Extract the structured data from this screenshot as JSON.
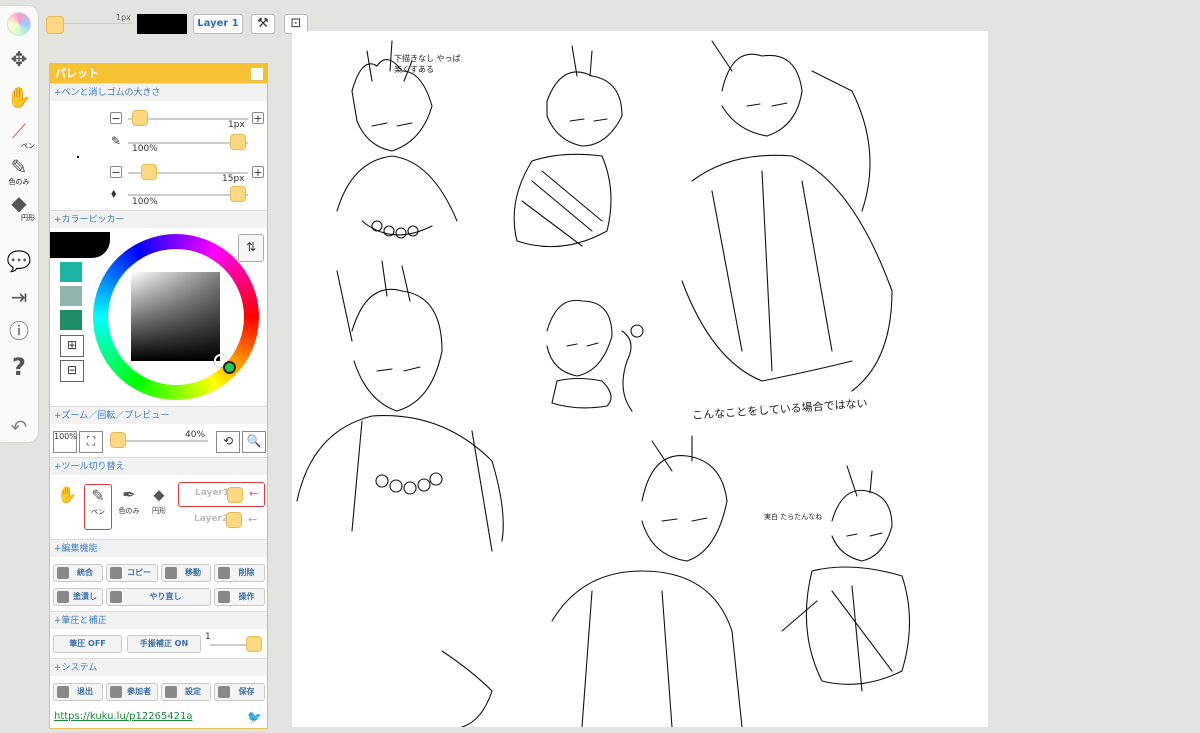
{
  "topbar": {
    "pen_size": "1px",
    "layer_label": "Layer 1",
    "current_color": "#000000"
  },
  "toolstrip": {
    "pen_label": "ペン",
    "eyedropper_label": "色のみ",
    "shape_label": "円形"
  },
  "palette": {
    "title": "パレット",
    "sections": {
      "brush_size": "+ペンと消しゴムの大きさ",
      "color_picker": "+カラーピッカー",
      "zoom": "+ズーム／回転／プレビュー",
      "tool_switch": "+ツール切り替え",
      "edit": "+編集機能",
      "pressure": "+筆圧と補正",
      "system": "+システム"
    },
    "pen": {
      "size": "1px",
      "opacity": "100%"
    },
    "eraser": {
      "size": "15px",
      "opacity": "100%"
    },
    "swatches": [
      "#1bb5a3",
      "#8fb5ac",
      "#1e8f65"
    ],
    "zoom": {
      "reset_label": "100%",
      "level": "40%"
    },
    "tools": {
      "pen_label": "ペン",
      "eyedropper_label": "色のみ",
      "shape_label": "円形",
      "layer1": "Layer1",
      "layer2": "Layer2"
    },
    "edit_buttons": {
      "merge": "統合",
      "copy": "コピー",
      "move": "移動",
      "delete": "削除",
      "fill": "塗潰し",
      "redo": "やり直し",
      "operation": "操作"
    },
    "pressure": {
      "pressure_btn": "筆圧 OFF",
      "stabilizer_btn": "手振補正 ON",
      "stabilizer_value": "1"
    },
    "system_buttons": {
      "exit": "退出",
      "participants": "参加者",
      "settings": "設定",
      "save": "保存"
    },
    "link": "https://kuku.lu/p12265421a"
  },
  "canvas": {
    "note_top": "下描きなし やっぱ 楽くすある",
    "note_mid": "こんなことをしている場合ではない",
    "note_bottom": "実白 たらたんなね"
  },
  "colors": {
    "accent": "#f6c234",
    "section_text": "#3a7bbf",
    "knob": "#ffd982",
    "active_border": "#e23b3b"
  }
}
